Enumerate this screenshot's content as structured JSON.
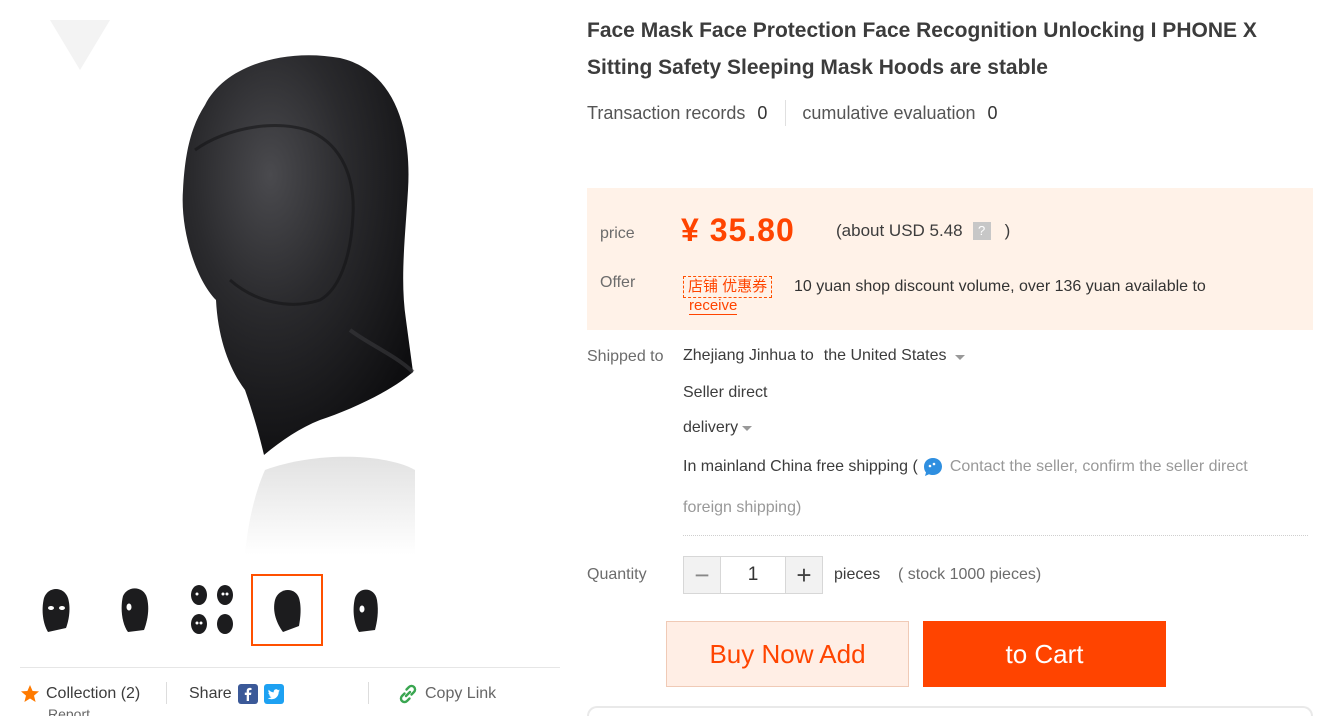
{
  "gallery": {
    "thumbnails": [
      "hood-open-eyes",
      "hood-open-eyes-side",
      "hood-variants-set",
      "hood-closed",
      "hood-open-eyes-alt"
    ],
    "active_index": 3
  },
  "actions": {
    "collection_label": "Collection (2)",
    "share_label": "Share",
    "copy_link_label": "Copy Link",
    "report_label": "Report"
  },
  "product": {
    "title": "Face Mask Face Protection Face Recognition Unlocking I PHONE X Sitting Safety Sleeping Mask Hoods are stable",
    "transaction_label": "Transaction records",
    "transaction_count": "0",
    "evaluation_label": "cumulative evaluation",
    "evaluation_count": "0"
  },
  "pricing": {
    "price_label": "price",
    "price": "¥ 35.80",
    "usd_prefix": "(about USD 5.48",
    "usd_suffix": ")",
    "qmark": "?",
    "offer_label": "Offer",
    "coupon_badge": "店铺 优惠券",
    "offer_text": "10 yuan shop discount volume, over 136 yuan available to",
    "receive_link": "receive"
  },
  "shipping": {
    "label": "Shipped to",
    "from": "Zhejiang Jinhua to",
    "destination": "the United States",
    "method_line": "Seller direct",
    "delivery": "delivery",
    "free_shipping": "In mainland China free shipping (",
    "contact_text": "Contact the seller, confirm the seller direct",
    "foreign_text": "foreign shipping)"
  },
  "quantity": {
    "label": "Quantity",
    "value": "1",
    "minus": "−",
    "plus": "+",
    "unit": "pieces",
    "stock": "( stock 1000 pieces)"
  },
  "buttons": {
    "buy_now": "Buy Now Add",
    "add_to_cart": "to Cart"
  },
  "colors": {
    "accent": "#ff4400",
    "price_panel_bg": "#fff2e8"
  }
}
